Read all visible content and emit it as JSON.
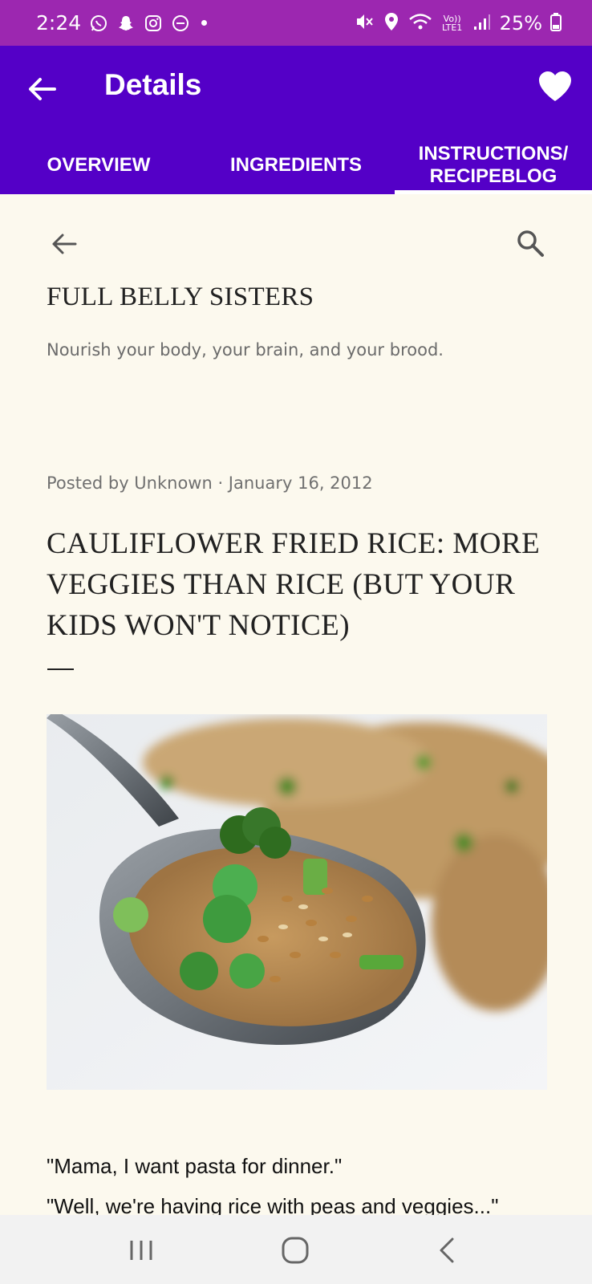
{
  "status_bar": {
    "time": "2:24",
    "battery": "25%",
    "icons": [
      "whatsapp-icon",
      "snapchat-icon",
      "instagram-icon",
      "do-not-disturb-icon",
      "mute-icon",
      "location-icon",
      "wifi-icon",
      "volte-icon",
      "signal-icon",
      "battery-icon"
    ],
    "network": "Vo)) LTE1"
  },
  "app_bar": {
    "title": "Details",
    "color": "#5400c7"
  },
  "tabs": [
    {
      "label": "OVERVIEW",
      "active": false
    },
    {
      "label": "INGREDIENTS",
      "active": false
    },
    {
      "label": "INSTRUCTIONS/ RECIPEBLOG",
      "active": true
    }
  ],
  "blog": {
    "name": "FULL BELLY SISTERS",
    "tagline": "Nourish your body, your brain, and your brood.",
    "post_meta": "Posted by Unknown · January 16, 2012",
    "post_title": "CAULIFLOWER FRIED RICE: MORE VEGGIES THAN RICE (BUT YOUR KIDS WON'T NOTICE)",
    "paragraphs": [
      "\"Mama, I want pasta for dinner.\"",
      "\"Well, we're having rice with peas and veggies...\""
    ]
  }
}
